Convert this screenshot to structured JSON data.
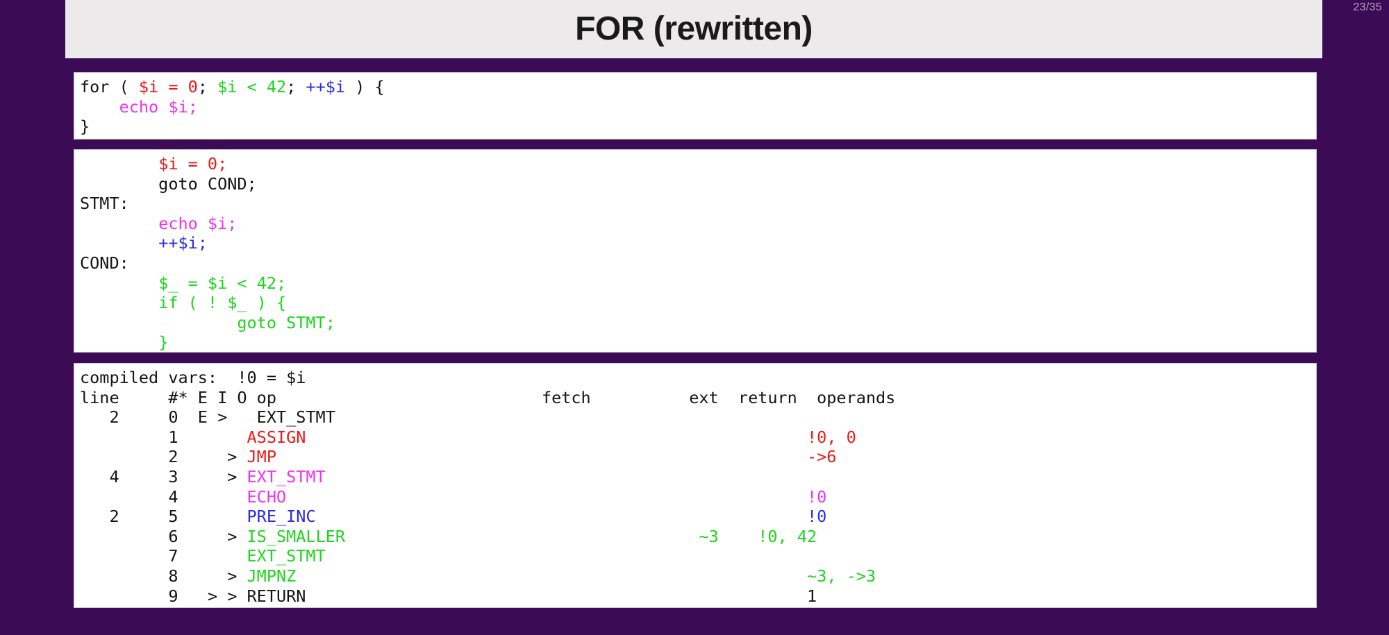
{
  "slide": {
    "title": "FOR (rewritten)",
    "page_counter": "23/35",
    "background_color": "#3b0b55",
    "title_bar_color": "#eceaea",
    "panel_color": "#ffffff"
  },
  "colors": {
    "init": "#f01717",
    "cond": "#1bd61b",
    "increment": "#2a2ae8",
    "body": "#ef32ef",
    "plain": "#141414"
  },
  "source_code": {
    "language": "php",
    "lines": [
      [
        {
          "text": "for ( ",
          "color": "plain"
        },
        {
          "text": "$i = 0",
          "color": "init"
        },
        {
          "text": "; ",
          "color": "plain"
        },
        {
          "text": "$i < 42",
          "color": "cond"
        },
        {
          "text": "; ",
          "color": "plain"
        },
        {
          "text": "++$i",
          "color": "increment"
        },
        {
          "text": " ) {",
          "color": "plain"
        }
      ],
      [
        {
          "text": "    ",
          "color": "plain"
        },
        {
          "text": "echo $i;",
          "color": "body"
        }
      ],
      [
        {
          "text": "}",
          "color": "plain"
        }
      ]
    ]
  },
  "rewritten_code": {
    "language": "php-goto",
    "lines": [
      [
        {
          "text": "        ",
          "color": "plain"
        },
        {
          "text": "$i = 0;",
          "color": "init"
        }
      ],
      [
        {
          "text": "        goto COND;",
          "color": "plain"
        }
      ],
      [
        {
          "text": "STMT:",
          "color": "plain"
        }
      ],
      [
        {
          "text": "        ",
          "color": "plain"
        },
        {
          "text": "echo $i;",
          "color": "body"
        }
      ],
      [
        {
          "text": "        ",
          "color": "plain"
        },
        {
          "text": "++$i;",
          "color": "increment"
        }
      ],
      [
        {
          "text": "COND:",
          "color": "plain"
        }
      ],
      [
        {
          "text": "        ",
          "color": "plain"
        },
        {
          "text": "$_ = $i < 42;",
          "color": "cond"
        }
      ],
      [
        {
          "text": "        ",
          "color": "plain"
        },
        {
          "text": "if ( ! $_ ) {",
          "color": "cond"
        }
      ],
      [
        {
          "text": "                ",
          "color": "plain"
        },
        {
          "text": "goto STMT;",
          "color": "cond"
        }
      ],
      [
        {
          "text": "        ",
          "color": "plain"
        },
        {
          "text": "}",
          "color": "cond"
        }
      ]
    ]
  },
  "opcodes": {
    "compiled_vars_label": "compiled vars:  !0 = $i",
    "columns": [
      "line",
      "#*",
      "E",
      "I",
      "O",
      "op",
      "fetch",
      "ext",
      "return",
      "operands"
    ],
    "header_line": "line     #* E I O op                           fetch          ext  return  operands",
    "rows": [
      {
        "line": "2",
        "num": "0",
        "flags": "E >",
        "op": "EXT_STMT",
        "ext": "",
        "return": "",
        "operands": "",
        "color": "plain"
      },
      {
        "line": "",
        "num": "1",
        "flags": "",
        "op": "ASSIGN",
        "ext": "",
        "return": "",
        "operands": "!0, 0",
        "color": "init"
      },
      {
        "line": "",
        "num": "2",
        "flags": ">",
        "op": "JMP",
        "ext": "",
        "return": "",
        "operands": "->6",
        "color": "init"
      },
      {
        "line": "4",
        "num": "3",
        "flags": ">",
        "op": "EXT_STMT",
        "ext": "",
        "return": "",
        "operands": "",
        "color": "body"
      },
      {
        "line": "",
        "num": "4",
        "flags": "",
        "op": "ECHO",
        "ext": "",
        "return": "",
        "operands": "!0",
        "color": "body"
      },
      {
        "line": "2",
        "num": "5",
        "flags": "",
        "op": "PRE_INC",
        "ext": "",
        "return": "",
        "operands": "!0",
        "color": "increment"
      },
      {
        "line": "",
        "num": "6",
        "flags": ">",
        "op": "IS_SMALLER",
        "ext": "",
        "return": "~3",
        "operands": "!0, 42",
        "color": "cond"
      },
      {
        "line": "",
        "num": "7",
        "flags": "",
        "op": "EXT_STMT",
        "ext": "",
        "return": "",
        "operands": "",
        "color": "cond"
      },
      {
        "line": "",
        "num": "8",
        "flags": ">",
        "op": "JMPNZ",
        "ext": "",
        "return": "",
        "operands": "~3, ->3",
        "color": "cond"
      },
      {
        "line": "",
        "num": "9",
        "flags": "> >",
        "op": "RETURN",
        "ext": "",
        "return": "",
        "operands": "1",
        "color": "plain"
      }
    ],
    "raw_lines": [
      {
        "segments": [
          {
            "text": "compiled vars:  !0 = $i",
            "color": "plain"
          }
        ]
      },
      {
        "segments": [
          {
            "text": "line     #* E I O op                           fetch          ext  return  operands",
            "color": "plain"
          }
        ]
      },
      {
        "segments": [
          {
            "text": "   2     0  E >   EXT_STMT                                                 ",
            "color": "plain"
          }
        ]
      },
      {
        "segments": [
          {
            "text": "         1       ",
            "color": "plain"
          },
          {
            "text": "ASSIGN",
            "color": "init"
          },
          {
            "text": "                                                   ",
            "color": "plain"
          },
          {
            "text": "!0, 0",
            "color": "init"
          }
        ]
      },
      {
        "segments": [
          {
            "text": "         2     > ",
            "color": "plain"
          },
          {
            "text": "JMP",
            "color": "init"
          },
          {
            "text": "                                                      ",
            "color": "plain"
          },
          {
            "text": "->6",
            "color": "init"
          }
        ]
      },
      {
        "segments": [
          {
            "text": "   4     3     > ",
            "color": "plain"
          },
          {
            "text": "EXT_STMT",
            "color": "body"
          }
        ]
      },
      {
        "segments": [
          {
            "text": "         4       ",
            "color": "plain"
          },
          {
            "text": "ECHO",
            "color": "body"
          },
          {
            "text": "                                                     ",
            "color": "plain"
          },
          {
            "text": "!0",
            "color": "body"
          }
        ]
      },
      {
        "segments": [
          {
            "text": "   2     5       ",
            "color": "plain"
          },
          {
            "text": "PRE_INC",
            "color": "increment"
          },
          {
            "text": "                                                  ",
            "color": "plain"
          },
          {
            "text": "!0",
            "color": "increment"
          }
        ]
      },
      {
        "segments": [
          {
            "text": "         6     > ",
            "color": "plain"
          },
          {
            "text": "IS_SMALLER",
            "color": "cond"
          },
          {
            "text": "                                    ",
            "color": "plain"
          },
          {
            "text": "~3",
            "color": "cond"
          },
          {
            "text": "    ",
            "color": "plain"
          },
          {
            "text": "!0, 42",
            "color": "cond"
          }
        ]
      },
      {
        "segments": [
          {
            "text": "         7       ",
            "color": "plain"
          },
          {
            "text": "EXT_STMT",
            "color": "cond"
          }
        ]
      },
      {
        "segments": [
          {
            "text": "         8     > ",
            "color": "plain"
          },
          {
            "text": "JMPNZ",
            "color": "cond"
          },
          {
            "text": "                                                    ",
            "color": "plain"
          },
          {
            "text": "~3, ->3",
            "color": "cond"
          }
        ]
      },
      {
        "segments": [
          {
            "text": "         9   > > ",
            "color": "plain"
          },
          {
            "text": "RETURN",
            "color": "plain"
          },
          {
            "text": "                                                   ",
            "color": "plain"
          },
          {
            "text": "1",
            "color": "plain"
          }
        ]
      }
    ]
  }
}
